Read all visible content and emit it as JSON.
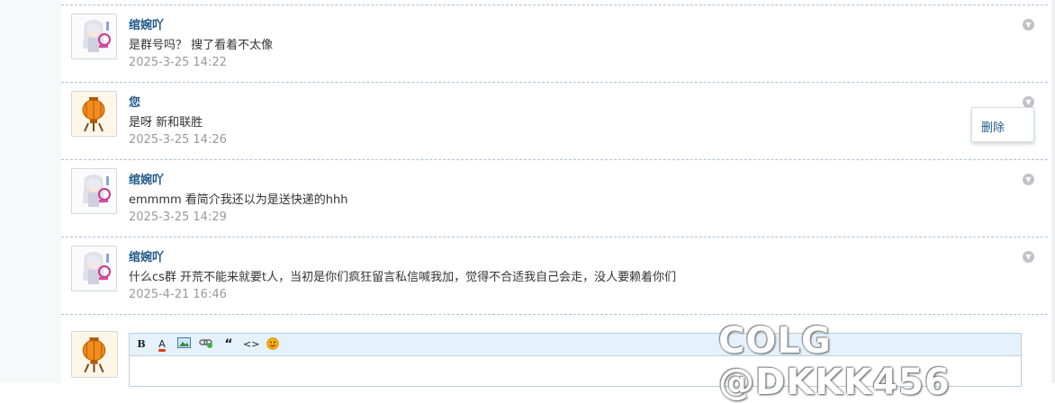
{
  "messages": [
    {
      "author": "绾婉吖",
      "text": "是群号吗？ 搜了看着不太像",
      "time": "2025-3-25 14:22",
      "avatar": "anime-girl-avatar"
    },
    {
      "author": "您",
      "text": "是呀 新和联胜",
      "time": "2025-3-25 14:26",
      "avatar": "lantern-avatar"
    },
    {
      "author": "绾婉吖",
      "text": "emmmm 看简介我还以为是送快递的hhh",
      "time": "2025-3-25 14:29",
      "avatar": "anime-girl-avatar"
    },
    {
      "author": "绾婉吖",
      "text": "什么cs群 开荒不能来就要t人，当初是你们疯狂留言私信喊我加，觉得不合适我自己会走，没人要赖着你们",
      "time": "2025-4-21 16:46",
      "avatar": "anime-girl-avatar"
    }
  ],
  "popup": {
    "delete_label": "删除"
  },
  "editor": {
    "toolbar": [
      {
        "name": "bold",
        "label": "B"
      },
      {
        "name": "font-color",
        "label": "A"
      },
      {
        "name": "image",
        "label": ""
      },
      {
        "name": "link",
        "label": ""
      },
      {
        "name": "quote",
        "label": "“"
      },
      {
        "name": "code",
        "label": "<>"
      },
      {
        "name": "emoji",
        "label": ""
      }
    ]
  },
  "watermark": "COLG @DKKK456",
  "colors": {
    "link": "#1f5a8a",
    "separator": "#a9c1d6",
    "toolbar_bg": "#e5f2fb"
  }
}
